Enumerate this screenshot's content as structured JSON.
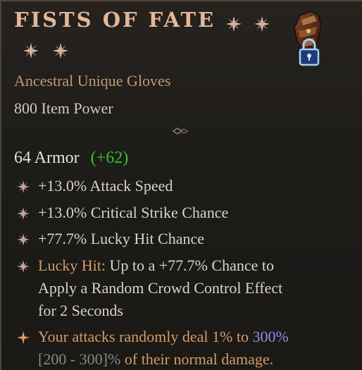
{
  "item": {
    "name": "FISTS OF FATE",
    "type": "Ancestral Unique Gloves",
    "item_power": "800 Item Power",
    "armor_value": "64 Armor",
    "armor_bonus": "(+62)",
    "image_icon": "gloves-item-icon",
    "lock_icon": "padlock-icon"
  },
  "affixes": [
    {
      "text": "+13.0% Attack Speed"
    },
    {
      "text": "+13.0% Critical Strike Chance"
    },
    {
      "text": "+77.7% Lucky Hit Chance"
    }
  ],
  "lucky_hit": {
    "label": "Lucky Hit:",
    "line1": "Up to a +77.7% Chance to",
    "line2": "Apply a Random Crowd Control Effect",
    "line3": "for 2 Seconds"
  },
  "unique_power": {
    "part1": "Your attacks randomly deal 1% to",
    "value": "300%",
    "range": "[200 - 300]%",
    "part2": "of their normal damage."
  },
  "colors": {
    "title": "#e3b89a",
    "legendary_orange": "#c49a6c",
    "bonus_green": "#2fc52f",
    "max_value_blue": "#8f8fe8",
    "unique_text": "#d49a62"
  }
}
